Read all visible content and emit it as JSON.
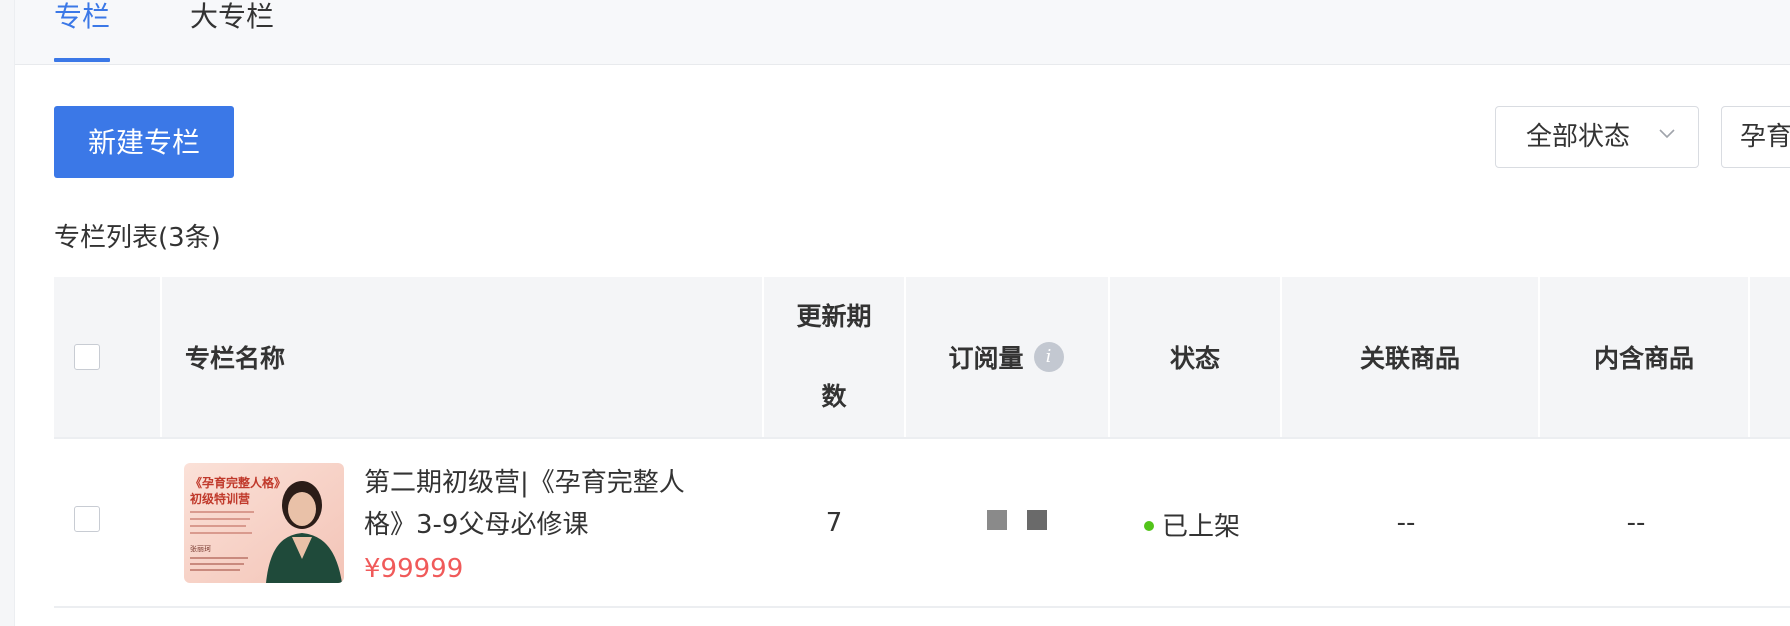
{
  "tabs": [
    {
      "label": "专栏",
      "active": true
    },
    {
      "label": "大专栏",
      "active": false
    }
  ],
  "toolbar": {
    "new_button": "新建专栏",
    "status_filter": "全部状态",
    "search_value": "孕育"
  },
  "list": {
    "title": "专栏列表(3条)"
  },
  "table": {
    "columns": {
      "name": "专栏名称",
      "periods_line1": "更新期",
      "periods_line2": "数",
      "subscriptions": "订阅量",
      "status": "状态",
      "related": "关联商品",
      "contains": "内含商品"
    },
    "info_glyph": "i",
    "rows": [
      {
        "title": "第二期初级营|《孕育完整人格》3-9父母必修课",
        "price": "¥99999",
        "periods": "7",
        "status": "已上架",
        "related": "--",
        "contains": "--",
        "thumb": {
          "line1": "《孕育完整人格》",
          "line2": "初级特训营",
          "name": "张丽珂"
        }
      }
    ]
  },
  "colors": {
    "accent": "#3b78e7",
    "price": "#f05a5a",
    "status_online": "#52c41a"
  }
}
